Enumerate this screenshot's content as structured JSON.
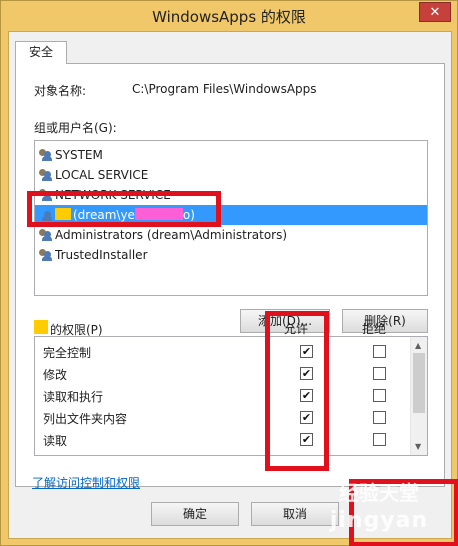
{
  "window": {
    "title": "WindowsApps 的权限",
    "close_glyph": "✕"
  },
  "tab": {
    "label": "安全"
  },
  "object": {
    "label": "对象名称:",
    "path": "C:\\Program Files\\WindowsApps"
  },
  "groups": {
    "label": "组或用户名(G):",
    "items": [
      {
        "label": "SYSTEM",
        "icon": "users-icon"
      },
      {
        "label": "LOCAL SERVICE",
        "icon": "users-icon"
      },
      {
        "label": "NETWORK SERVICE",
        "icon": "users-icon"
      },
      {
        "label": "(dream\\ye",
        "label_end": "o)",
        "icon": "user-icon",
        "selected": true
      },
      {
        "label": "Administrators (dream\\Administrators)",
        "icon": "users-icon"
      },
      {
        "label": "TrustedInstaller",
        "icon": "users-icon"
      }
    ]
  },
  "buttons": {
    "add": "添加(D)...",
    "remove": "删除(R)",
    "ok": "确定",
    "cancel": "取消"
  },
  "permissions": {
    "label": "的权限(P)",
    "allow_header": "允许",
    "deny_header": "拒绝",
    "rows": [
      {
        "name": "完全控制",
        "allow": true,
        "deny": false
      },
      {
        "name": "修改",
        "allow": true,
        "deny": false
      },
      {
        "name": "读取和执行",
        "allow": true,
        "deny": false
      },
      {
        "name": "列出文件夹内容",
        "allow": true,
        "deny": false
      },
      {
        "name": "读取",
        "allow": true,
        "deny": false
      }
    ],
    "check_glyph": "✔"
  },
  "link": {
    "label": "了解访问控制和权限"
  },
  "watermark": {
    "line1": "经验天堂",
    "line2": "jingyan"
  },
  "colors": {
    "highlight": "#e0101c",
    "selection": "#3399ff",
    "title_bg": "#f0c86a",
    "close": "#c7413c"
  }
}
